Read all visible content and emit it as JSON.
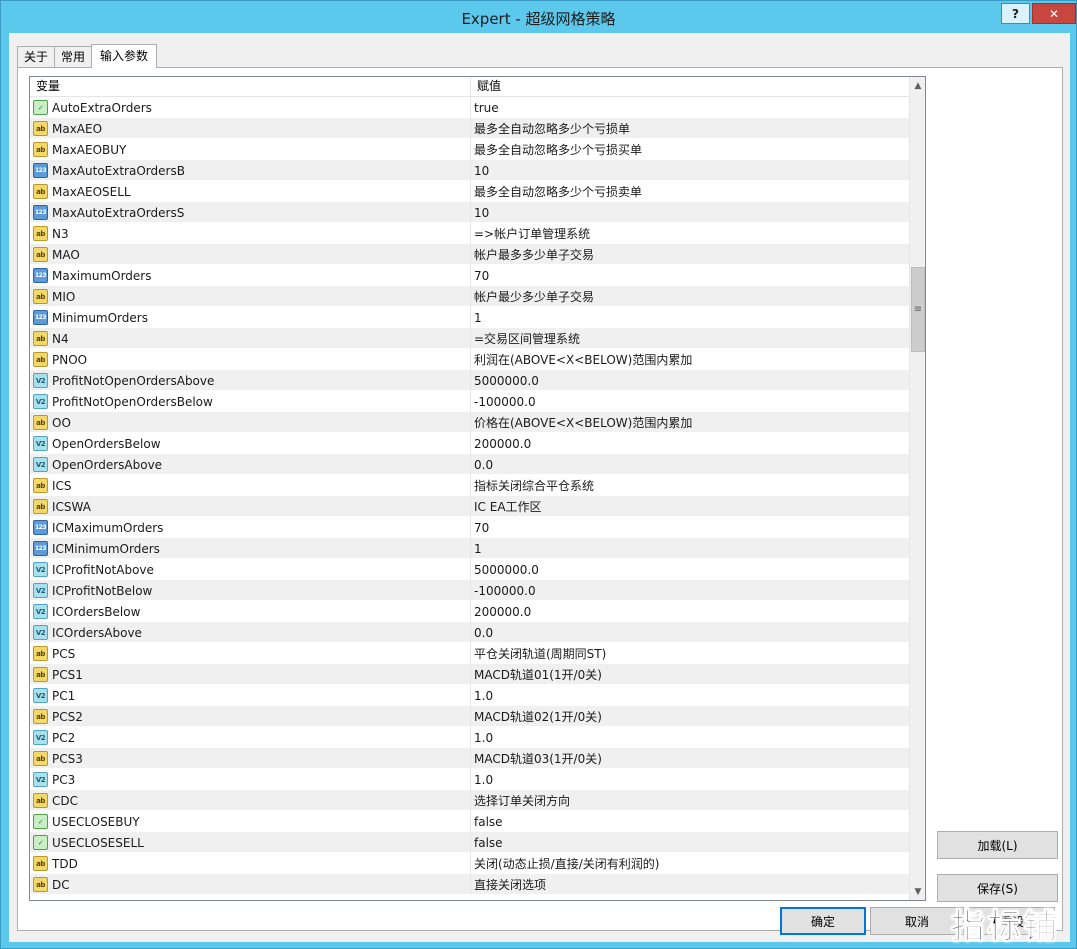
{
  "window": {
    "title": "Expert - 超级网格策略",
    "help_label": "?",
    "close_label": "✕"
  },
  "tabs": [
    {
      "label": "关于"
    },
    {
      "label": "常用"
    },
    {
      "label": "输入参数"
    }
  ],
  "grid": {
    "headers": {
      "variable": "变量",
      "value": "赋值"
    },
    "rows": [
      {
        "type": "bool",
        "name": "AutoExtraOrders",
        "value": "true"
      },
      {
        "type": "str",
        "name": "MaxAEO",
        "value": "最多全自动忽略多少个亏损单"
      },
      {
        "type": "str",
        "name": "MaxAEOBUY",
        "value": "最多全自动忽略多少个亏损买单"
      },
      {
        "type": "int",
        "name": "MaxAutoExtraOrdersB",
        "value": "10"
      },
      {
        "type": "str",
        "name": "MaxAEOSELL",
        "value": "最多全自动忽略多少个亏损卖单"
      },
      {
        "type": "int",
        "name": "MaxAutoExtraOrdersS",
        "value": "10"
      },
      {
        "type": "str",
        "name": "N3",
        "value": "=>帐户订单管理系统"
      },
      {
        "type": "str",
        "name": "MAO",
        "value": "帐户最多多少单子交易"
      },
      {
        "type": "int",
        "name": "MaximumOrders",
        "value": "70"
      },
      {
        "type": "str",
        "name": "MIO",
        "value": "帐户最少多少单子交易"
      },
      {
        "type": "int",
        "name": "MinimumOrders",
        "value": "1"
      },
      {
        "type": "str",
        "name": "N4",
        "value": "=交易区间管理系统"
      },
      {
        "type": "str",
        "name": "PNOO",
        "value": "利润在(ABOVE<X<BELOW)范围内累加"
      },
      {
        "type": "dbl",
        "name": "ProfitNotOpenOrdersAbove",
        "value": "5000000.0"
      },
      {
        "type": "dbl",
        "name": "ProfitNotOpenOrdersBelow",
        "value": "-100000.0"
      },
      {
        "type": "str",
        "name": "OO",
        "value": "价格在(ABOVE<X<BELOW)范围内累加"
      },
      {
        "type": "dbl",
        "name": "OpenOrdersBelow",
        "value": "200000.0"
      },
      {
        "type": "dbl",
        "name": "OpenOrdersAbove",
        "value": "0.0"
      },
      {
        "type": "str",
        "name": "ICS",
        "value": "指标关闭综合平仓系统"
      },
      {
        "type": "str",
        "name": "ICSWA",
        "value": "IC EA工作区"
      },
      {
        "type": "int",
        "name": "ICMaximumOrders",
        "value": "70"
      },
      {
        "type": "int",
        "name": "ICMinimumOrders",
        "value": "1"
      },
      {
        "type": "dbl",
        "name": "ICProfitNotAbove",
        "value": "5000000.0"
      },
      {
        "type": "dbl",
        "name": "ICProfitNotBelow",
        "value": "-100000.0"
      },
      {
        "type": "dbl",
        "name": "ICOrdersBelow",
        "value": "200000.0"
      },
      {
        "type": "dbl",
        "name": "ICOrdersAbove",
        "value": "0.0"
      },
      {
        "type": "str",
        "name": "PCS",
        "value": "平仓关闭轨道(周期同ST)"
      },
      {
        "type": "str",
        "name": "PCS1",
        "value": "MACD轨道01(1开/0关)"
      },
      {
        "type": "dbl",
        "name": "PC1",
        "value": "1.0"
      },
      {
        "type": "str",
        "name": "PCS2",
        "value": "MACD轨道02(1开/0关)"
      },
      {
        "type": "dbl",
        "name": "PC2",
        "value": "1.0"
      },
      {
        "type": "str",
        "name": "PCS3",
        "value": "MACD轨道03(1开/0关)"
      },
      {
        "type": "dbl",
        "name": "PC3",
        "value": "1.0"
      },
      {
        "type": "str",
        "name": "CDC",
        "value": "选择订单关闭方向"
      },
      {
        "type": "bool",
        "name": "USECLOSEBUY",
        "value": "false"
      },
      {
        "type": "bool",
        "name": "USECLOSESELL",
        "value": "false"
      },
      {
        "type": "str",
        "name": "TDD",
        "value": "关闭(动态止损/直接/关闭有利润的)"
      },
      {
        "type": "str",
        "name": "DC",
        "value": "直接关闭选项"
      }
    ]
  },
  "icon_glyphs": {
    "str": "ab",
    "int": "123",
    "dbl": "V2",
    "bool": "✓"
  },
  "buttons": {
    "load": "加载(L)",
    "save": "保存(S)",
    "ok": "确定",
    "cancel": "取消",
    "reset": "重设"
  },
  "watermark": "指标铺"
}
